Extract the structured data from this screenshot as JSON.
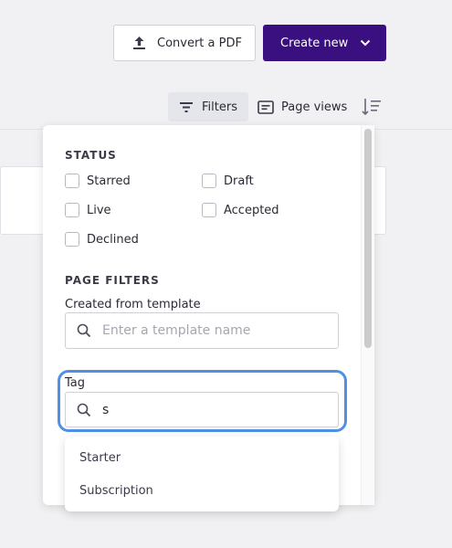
{
  "toolbar": {
    "convert_label": "Convert a PDF",
    "convert_icon": "upload-icon",
    "create_label": "Create new",
    "create_icon": "chevron-down-icon",
    "filters_label": "Filters",
    "filters_icon": "filter-icon",
    "page_views_label": "Page views",
    "page_views_icon": "page-views-icon",
    "sort_icon": "sort-icon"
  },
  "filters_panel": {
    "status_heading": "STATUS",
    "status_options": [
      {
        "label": "Starred",
        "checked": false
      },
      {
        "label": "Draft",
        "checked": false
      },
      {
        "label": "Live",
        "checked": false
      },
      {
        "label": "Accepted",
        "checked": false
      },
      {
        "label": "Declined",
        "checked": false
      }
    ],
    "page_filters_heading": "PAGE FILTERS",
    "template_label": "Created from template",
    "template_placeholder": "Enter a template name",
    "template_value": "",
    "tag_label": "Tag",
    "tag_value": "s",
    "tag_suggestions": [
      "Starter",
      "Subscription"
    ]
  },
  "colors": {
    "primary": "#3a0f80",
    "focus_ring": "#4f8fe6",
    "background": "#f1f1f3"
  }
}
